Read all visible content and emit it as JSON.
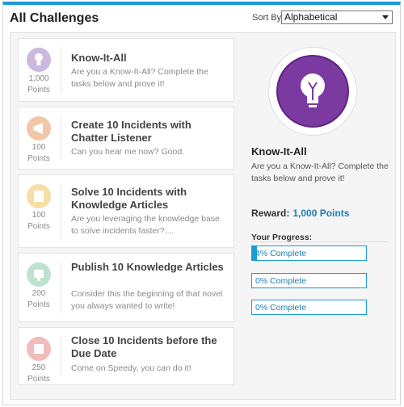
{
  "header": {
    "title": "All Challenges",
    "sort_label": "Sort By:",
    "sort_value": "Alphabetical"
  },
  "challenges": [
    {
      "title": "Know-It-All",
      "desc": "Are you a Know-It-All? Complete the tasks below and prove it!",
      "points_value": "1,000",
      "points_label": "Points",
      "icon": "lightbulb-icon",
      "color": "#cdb8e0"
    },
    {
      "title": "Create 10 Incidents with Chatter Listener",
      "desc": "Can you hear me now? Good.",
      "points_value": "100",
      "points_label": "Points",
      "icon": "megaphone-icon",
      "color": "#f2c6a8"
    },
    {
      "title": "Solve 10 Incidents with Knowledge Articles",
      "desc": "Are you leveraging the knowledge base to solve incidents faster?....",
      "points_value": "100",
      "points_label": "Points",
      "icon": "book-icon",
      "color": "#f6dea5"
    },
    {
      "title": "Publish 10 Knowledge Articles",
      "desc": "Consider this the beginning of that novel you always wanted to write!",
      "points_value": "200",
      "points_label": "Points",
      "icon": "pen-icon",
      "color": "#bfe2cf"
    },
    {
      "title": "Close 10 Incidents before the Due Date",
      "desc": "Come on Speedy, you can do it!",
      "points_value": "250",
      "points_label": "Points",
      "icon": "calendar-icon",
      "color": "#f2bcbc"
    }
  ],
  "detail": {
    "title": "Know-It-All",
    "desc": "Are you a Know-It-All? Complete the tasks below and prove it!",
    "reward_label": "Reward:",
    "reward_value": "1,000 Points",
    "progress_label": "Your Progress:",
    "progress": [
      {
        "text": "4% Complete",
        "percent": 4
      },
      {
        "text": "0% Complete",
        "percent": 0
      },
      {
        "text": "0% Complete",
        "percent": 0
      }
    ]
  },
  "colors": {
    "accent": "#1a9bd4",
    "badge": "#7b3a9f"
  }
}
